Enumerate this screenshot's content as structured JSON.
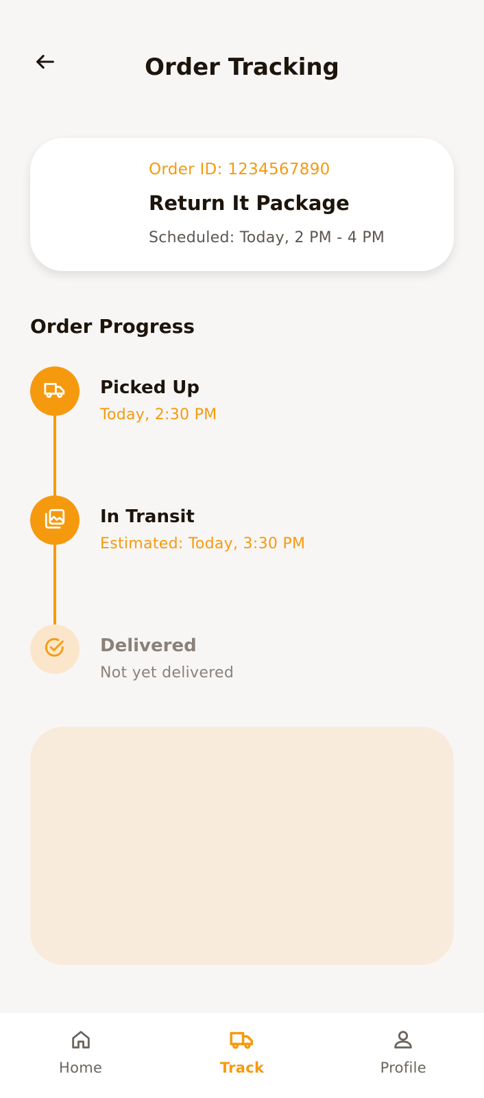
{
  "header": {
    "title": "Order Tracking",
    "back_icon": "arrow-left-icon"
  },
  "order": {
    "id_label": "Order ID: 1234567890",
    "name": "Return It Package",
    "schedule": "Scheduled: Today, 2 PM - 4 PM"
  },
  "progress": {
    "title": "Order Progress",
    "steps": [
      {
        "title": "Picked Up",
        "subtitle": "Today, 2:30 PM",
        "status": "done",
        "icon": "truck-icon"
      },
      {
        "title": "In Transit",
        "subtitle": "Estimated: Today, 3:30 PM",
        "status": "done",
        "icon": "gallery-icon"
      },
      {
        "title": "Delivered",
        "subtitle": "Not yet delivered",
        "status": "pending",
        "icon": "check-circle-icon"
      }
    ]
  },
  "nav": {
    "items": [
      {
        "label": "Home",
        "icon": "home-icon",
        "active": false
      },
      {
        "label": "Track",
        "icon": "truck-icon",
        "active": true
      },
      {
        "label": "Profile",
        "icon": "user-icon",
        "active": false
      }
    ]
  },
  "colors": {
    "accent": "#f59a0e",
    "accent_light": "#fbe6cc",
    "background": "#f8f6f5",
    "map_placeholder": "#f8ebdc",
    "text_dark": "#1d140c",
    "text_muted": "#8a8179"
  }
}
